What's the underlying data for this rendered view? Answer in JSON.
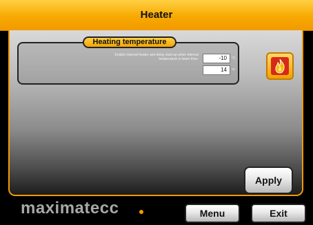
{
  "window": {
    "title": "Heater"
  },
  "heating": {
    "group_title": "Heating temperature",
    "description": "Enable internal heater and delay start-up when internal temperature is lower than.",
    "celsius_value": "-10",
    "celsius_unit": "°C",
    "fahrenheit_value": "14",
    "fahrenheit_unit": "°F"
  },
  "icons": {
    "heater": "flame-icon"
  },
  "buttons": {
    "apply": "Apply",
    "menu": "Menu",
    "exit": "Exit"
  },
  "brand": {
    "logo": "maximatecc"
  },
  "colors": {
    "accent": "#f29a00",
    "heater_icon_bg": "#d72a15"
  }
}
